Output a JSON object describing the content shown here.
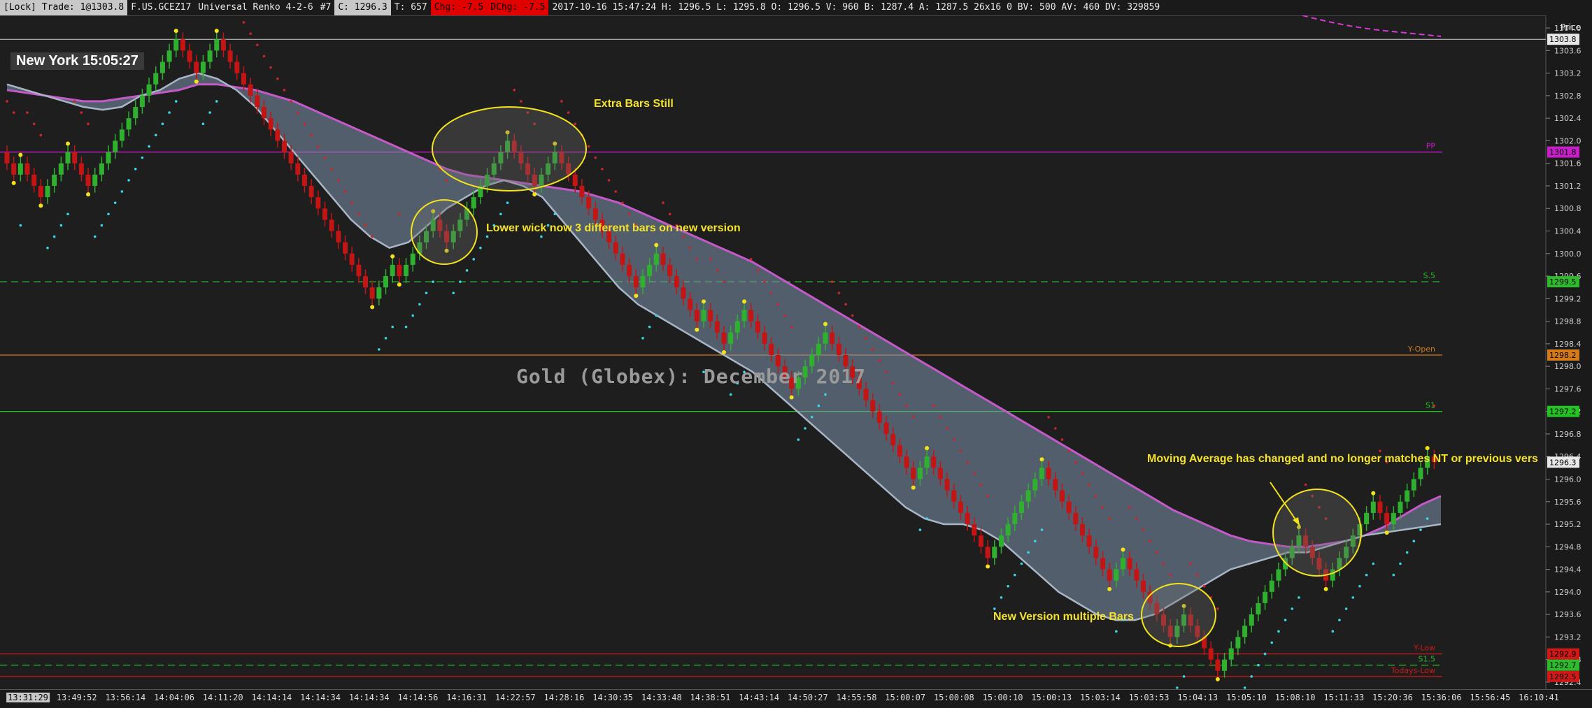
{
  "status_bar": {
    "lock": "[Lock] Trade: 1@1303.8",
    "symbol": "F.US.GCEZ17",
    "bar_type": "Universal Renko 4-2-6",
    "chart_num": "#7",
    "close": "C: 1296.3",
    "ticks": "T: 657",
    "chg": "Chg: -7.5",
    "dchg": "DChg: -7.5",
    "ohlc": "2017-10-16 15:47:24 H: 1296.5 L: 1295.8 O: 1296.5 V: 960 B: 1287.4 A: 1287.5 26x16 0 BV: 500 AV: 460 DV: 329859"
  },
  "clock": "New York 15:05:27",
  "watermark": "Gold (Globex): December 2017",
  "annotations": {
    "extra_bars": "Extra Bars Still",
    "lower_wick": "Lower wick now 3 different bars on new version",
    "moving_avg": "Moving Average has changed and no longer matches NT or previous vers",
    "new_version": "New Version multiple Bars"
  },
  "price_axis": {
    "title": "Price",
    "ticks": [
      "1304.0",
      "1303.6",
      "1303.2",
      "1302.8",
      "1302.4",
      "1302.0",
      "1301.6",
      "1301.2",
      "1300.8",
      "1300.4",
      "1300.0",
      "1299.6",
      "1299.2",
      "1298.8",
      "1298.4",
      "1298.0",
      "1297.6",
      "1297.2",
      "1296.8",
      "1296.4",
      "1296.0",
      "1295.6",
      "1295.2",
      "1294.8",
      "1294.4",
      "1294.0",
      "1293.6",
      "1293.2",
      "1292.8",
      "1292.4"
    ]
  },
  "levels": [
    {
      "label": "PP",
      "price": 1301.8,
      "badge": "1301.8",
      "color": "#c51fc5",
      "style": "solid"
    },
    {
      "label": "S.5",
      "price": 1299.5,
      "badge": "1299.5",
      "color": "#2dbb2d",
      "style": "dashed"
    },
    {
      "label": "Y-Open",
      "price": 1298.2,
      "badge": "1298.2",
      "color": "#d47a1a",
      "style": "solid"
    },
    {
      "label": "S1",
      "price": 1297.2,
      "badge": "1297.2",
      "color": "#22c322",
      "style": "solid"
    },
    {
      "label": "Y-Low",
      "price": 1292.9,
      "badge": "1292.9",
      "color": "#d01818",
      "style": "solid"
    },
    {
      "label": "S1.5",
      "price": 1292.7,
      "badge": "1292.7",
      "color": "#2dbb2d",
      "style": "dashed"
    },
    {
      "label": "Todays-Low",
      "price": 1292.5,
      "badge": "1292.5",
      "color": "#d01818",
      "style": "solid"
    }
  ],
  "top_line": {
    "price": 1303.8,
    "badge": "1303.8",
    "color": "#cfcfcf"
  },
  "current_price": {
    "badge": "1296.3",
    "color": "#e8e8e8"
  },
  "time_axis": [
    "13:31:29",
    "13:49:52",
    "13:56:14",
    "14:04:06",
    "14:11:20",
    "14:14:14",
    "14:14:34",
    "14:14:34",
    "14:14:56",
    "14:16:31",
    "14:22:57",
    "14:28:16",
    "14:30:35",
    "14:33:48",
    "14:38:51",
    "14:43:14",
    "14:50:27",
    "14:55:58",
    "15:00:07",
    "15:00:08",
    "15:00:10",
    "15:00:13",
    "15:03:14",
    "15:03:53",
    "15:04:13",
    "15:05:10",
    "15:08:10",
    "15:11:33",
    "15:20:36",
    "15:36:06",
    "15:56:45",
    "16:10:41"
  ],
  "chart_data": {
    "type": "candlestick",
    "title": "Gold (Globex): December 2017",
    "ylim": [
      1292.3,
      1304.1
    ],
    "close": [
      1301.6,
      1301.4,
      1301.6,
      1301.4,
      1301.2,
      1301.0,
      1301.2,
      1301.4,
      1301.6,
      1301.8,
      1301.6,
      1301.4,
      1301.2,
      1301.4,
      1301.6,
      1301.8,
      1302.0,
      1302.2,
      1302.4,
      1302.6,
      1302.8,
      1303.0,
      1303.2,
      1303.4,
      1303.6,
      1303.8,
      1303.6,
      1303.4,
      1303.2,
      1303.4,
      1303.6,
      1303.8,
      1303.6,
      1303.4,
      1303.2,
      1303.0,
      1302.8,
      1302.6,
      1302.4,
      1302.2,
      1302.0,
      1301.8,
      1301.6,
      1301.4,
      1301.2,
      1301.0,
      1300.8,
      1300.6,
      1300.4,
      1300.2,
      1300.0,
      1299.8,
      1299.6,
      1299.4,
      1299.2,
      1299.4,
      1299.6,
      1299.8,
      1299.6,
      1299.8,
      1300.0,
      1300.2,
      1300.4,
      1300.6,
      1300.4,
      1300.2,
      1300.4,
      1300.6,
      1300.8,
      1301.0,
      1301.2,
      1301.4,
      1301.6,
      1301.8,
      1302.0,
      1301.8,
      1301.6,
      1301.4,
      1301.2,
      1301.4,
      1301.6,
      1301.8,
      1301.6,
      1301.4,
      1301.2,
      1301.0,
      1300.8,
      1300.6,
      1300.4,
      1300.2,
      1300.0,
      1299.8,
      1299.6,
      1299.4,
      1299.6,
      1299.8,
      1300.0,
      1299.8,
      1299.6,
      1299.4,
      1299.2,
      1299.0,
      1298.8,
      1299.0,
      1298.8,
      1298.6,
      1298.4,
      1298.6,
      1298.8,
      1299.0,
      1298.8,
      1298.6,
      1298.4,
      1298.2,
      1298.0,
      1297.8,
      1297.6,
      1297.8,
      1298.0,
      1298.2,
      1298.4,
      1298.6,
      1298.4,
      1298.2,
      1298.0,
      1297.8,
      1297.6,
      1297.4,
      1297.2,
      1297.0,
      1296.8,
      1296.6,
      1296.4,
      1296.2,
      1296.0,
      1296.2,
      1296.4,
      1296.2,
      1296.0,
      1295.8,
      1295.6,
      1295.4,
      1295.2,
      1295.0,
      1294.8,
      1294.6,
      1294.8,
      1295.0,
      1295.2,
      1295.4,
      1295.6,
      1295.8,
      1296.0,
      1296.2,
      1296.0,
      1295.8,
      1295.6,
      1295.4,
      1295.2,
      1295.0,
      1294.8,
      1294.6,
      1294.4,
      1294.2,
      1294.4,
      1294.6,
      1294.4,
      1294.2,
      1294.0,
      1293.8,
      1293.6,
      1293.4,
      1293.2,
      1293.4,
      1293.6,
      1293.4,
      1293.2,
      1293.0,
      1292.8,
      1292.6,
      1292.8,
      1293.0,
      1293.2,
      1293.4,
      1293.6,
      1293.8,
      1294.0,
      1294.2,
      1294.4,
      1294.6,
      1294.8,
      1295.0,
      1294.8,
      1294.6,
      1294.4,
      1294.2,
      1294.4,
      1294.6,
      1294.8,
      1295.0,
      1295.2,
      1295.4,
      1295.6,
      1295.4,
      1295.2,
      1295.4,
      1295.6,
      1295.8,
      1296.0,
      1296.2,
      1296.4,
      1296.3
    ],
    "ema": [
      1302.9,
      1302.85,
      1302.8,
      1302.75,
      1302.7,
      1302.7,
      1302.75,
      1302.8,
      1302.85,
      1302.9,
      1303.0,
      1303.0,
      1302.95,
      1302.9,
      1302.8,
      1302.7,
      1302.55,
      1302.4,
      1302.25,
      1302.1,
      1301.95,
      1301.8,
      1301.65,
      1301.5,
      1301.4,
      1301.35,
      1301.3,
      1301.25,
      1301.2,
      1301.15,
      1301.1,
      1301.0,
      1300.9,
      1300.75,
      1300.6,
      1300.45,
      1300.3,
      1300.15,
      1300.0,
      1299.85,
      1299.65,
      1299.45,
      1299.25,
      1299.05,
      1298.85,
      1298.65,
      1298.45,
      1298.25,
      1298.05,
      1297.85,
      1297.65,
      1297.45,
      1297.25,
      1297.05,
      1296.85,
      1296.65,
      1296.45,
      1296.25,
      1296.05,
      1295.85,
      1295.65,
      1295.45,
      1295.3,
      1295.15,
      1295.0,
      1294.9,
      1294.85,
      1294.8,
      1294.8,
      1294.85,
      1294.9,
      1295.0,
      1295.15,
      1295.35,
      1295.55,
      1295.7
    ],
    "ema_fast": [
      1303.0,
      1302.9,
      1302.8,
      1302.7,
      1302.6,
      1302.55,
      1302.6,
      1302.8,
      1302.9,
      1303.1,
      1303.2,
      1303.1,
      1302.9,
      1302.6,
      1302.2,
      1301.8,
      1301.4,
      1301.0,
      1300.6,
      1300.3,
      1300.1,
      1300.2,
      1300.5,
      1300.8,
      1301.0,
      1301.2,
      1301.3,
      1301.2,
      1301.0,
      1300.6,
      1300.2,
      1299.8,
      1299.4,
      1299.1,
      1298.9,
      1298.7,
      1298.5,
      1298.3,
      1298.1,
      1297.9,
      1297.6,
      1297.3,
      1297.0,
      1296.7,
      1296.4,
      1296.1,
      1295.8,
      1295.5,
      1295.3,
      1295.2,
      1295.2,
      1295.1,
      1294.9,
      1294.6,
      1294.3,
      1294.0,
      1293.8,
      1293.6,
      1293.5,
      1293.5,
      1293.6,
      1293.8,
      1294.0,
      1294.2,
      1294.4,
      1294.5,
      1294.6,
      1294.7,
      1294.7,
      1294.8,
      1294.9,
      1295.0,
      1295.05,
      1295.1,
      1295.15,
      1295.2
    ]
  }
}
